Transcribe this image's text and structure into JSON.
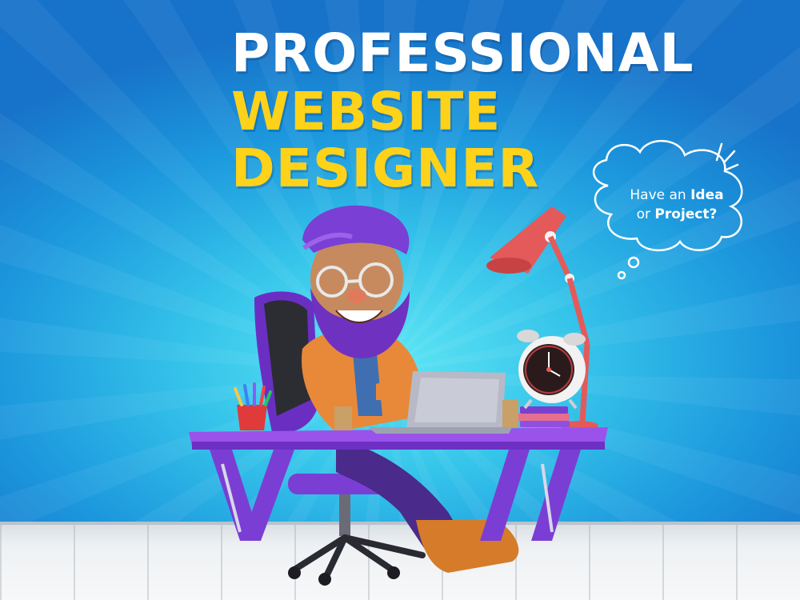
{
  "headline": {
    "line1": "PROFESSIONAL",
    "line2": "WEBSITE",
    "line3": "DESIGNER"
  },
  "thought_bubble": {
    "text_part1": "Have an ",
    "text_bold1": "Idea",
    "text_part2": "or ",
    "text_bold2": "Project?"
  },
  "colors": {
    "background_blue": "#1c7fd4",
    "headline_white": "#ffffff",
    "headline_yellow": "#ffd21a",
    "desk_purple": "#8a3fd8",
    "jacket_orange": "#e8893a",
    "lamp_red": "#e45a5a"
  },
  "icons": [
    "thought-cloud-icon",
    "sparkle-lines-icon",
    "lamp-icon",
    "alarm-clock-icon",
    "laptop-icon",
    "pencil-cup-icon",
    "books-icon"
  ]
}
